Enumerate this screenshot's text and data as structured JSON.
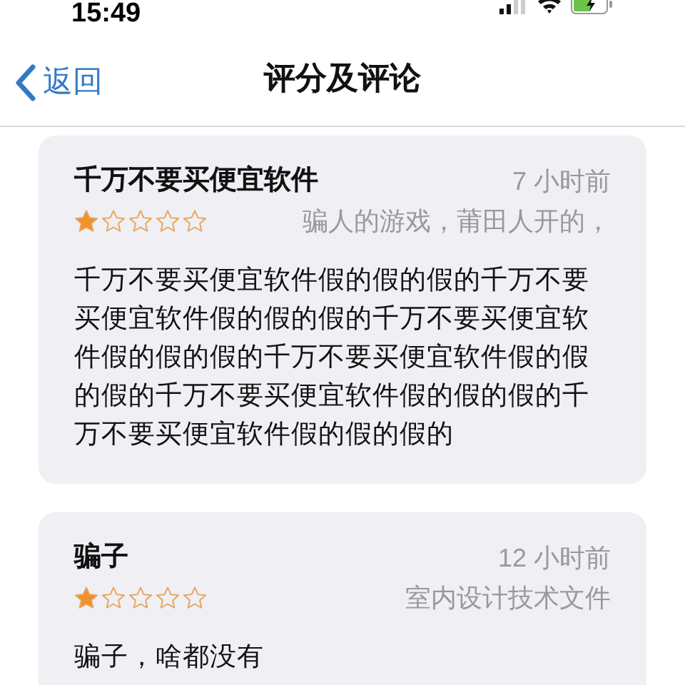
{
  "status_bar": {
    "time": "15:49"
  },
  "nav": {
    "back": "返回",
    "title": "评分及评论"
  },
  "reviews": [
    {
      "title": "千万不要买便宜软件",
      "time": "7 小时前",
      "stars": 1,
      "author": "骗人的游戏，莆田人开的，",
      "body": "千万不要买便宜软件假的假的假的千万不要买便宜软件假的假的假的千万不要买便宜软件假的假的假的千万不要买便宜软件假的假的假的千万不要买便宜软件假的假的假的千万不要买便宜软件假的假的假的"
    },
    {
      "title": "骗子",
      "time": "12 小时前",
      "stars": 1,
      "author": "室内设计技术文件",
      "body": "骗子，啥都没有"
    }
  ]
}
